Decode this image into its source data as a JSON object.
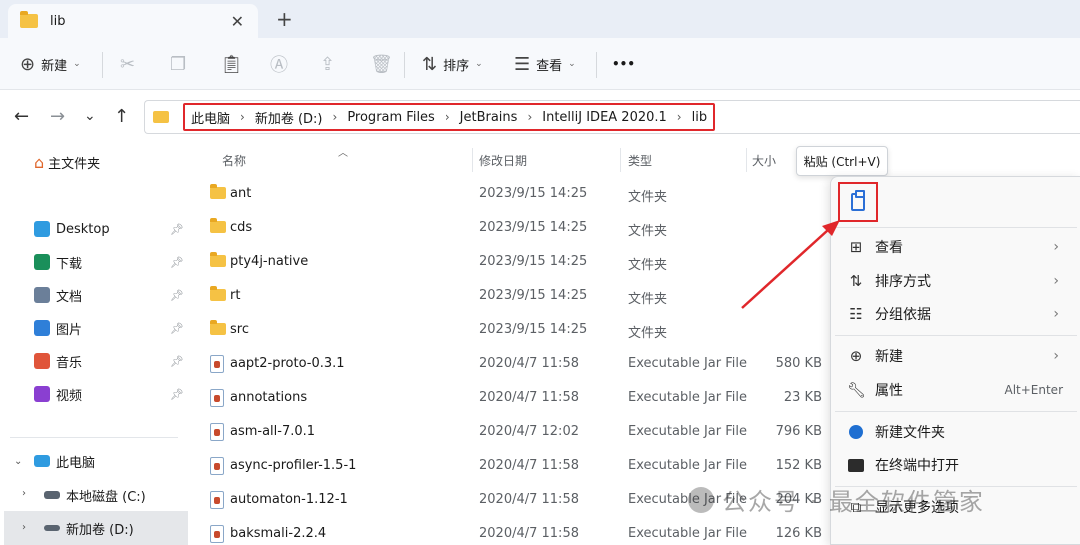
{
  "tab": {
    "title": "lib",
    "close": "✕",
    "add": "+"
  },
  "toolbar": {
    "new_label": "新建",
    "sort_label": "排序",
    "view_label": "查看",
    "more": "•••"
  },
  "nav": {
    "back": "←",
    "forward": "→",
    "recent": "⌄",
    "up": "↑"
  },
  "breadcrumb": [
    "此电脑",
    "新加卷 (D:)",
    "Program Files",
    "JetBrains",
    "IntelliJ IDEA 2020.1",
    "lib"
  ],
  "sidebar": {
    "home": "主文件夹",
    "quick": [
      {
        "label": "Desktop",
        "icon": "desktop-icon",
        "color": "#2f9be0"
      },
      {
        "label": "下载",
        "icon": "download-icon",
        "color": "#1a8f5a"
      },
      {
        "label": "文档",
        "icon": "document-icon",
        "color": "#6b7f99"
      },
      {
        "label": "图片",
        "icon": "picture-icon",
        "color": "#2f7fd8"
      },
      {
        "label": "音乐",
        "icon": "music-icon",
        "color": "#e0553a"
      },
      {
        "label": "视频",
        "icon": "video-icon",
        "color": "#8a3fd1"
      }
    ],
    "this_pc": "此电脑",
    "drive_c": "本地磁盘 (C:)",
    "drive_d": "新加卷 (D:)"
  },
  "columns": {
    "name": "名称",
    "date": "修改日期",
    "type": "类型",
    "size": "大小"
  },
  "files": [
    {
      "name": "ant",
      "date": "2023/9/15 14:25",
      "type": "文件夹",
      "size": "",
      "kind": "folder"
    },
    {
      "name": "cds",
      "date": "2023/9/15 14:25",
      "type": "文件夹",
      "size": "",
      "kind": "folder"
    },
    {
      "name": "pty4j-native",
      "date": "2023/9/15 14:25",
      "type": "文件夹",
      "size": "",
      "kind": "folder"
    },
    {
      "name": "rt",
      "date": "2023/9/15 14:25",
      "type": "文件夹",
      "size": "",
      "kind": "folder"
    },
    {
      "name": "src",
      "date": "2023/9/15 14:25",
      "type": "文件夹",
      "size": "",
      "kind": "folder"
    },
    {
      "name": "aapt2-proto-0.3.1",
      "date": "2020/4/7 11:58",
      "type": "Executable Jar File",
      "size": "580 KB",
      "kind": "jar"
    },
    {
      "name": "annotations",
      "date": "2020/4/7 11:58",
      "type": "Executable Jar File",
      "size": "23 KB",
      "kind": "jar"
    },
    {
      "name": "asm-all-7.0.1",
      "date": "2020/4/7 12:02",
      "type": "Executable Jar File",
      "size": "796 KB",
      "kind": "jar"
    },
    {
      "name": "async-profiler-1.5-1",
      "date": "2020/4/7 11:58",
      "type": "Executable Jar File",
      "size": "152 KB",
      "kind": "jar"
    },
    {
      "name": "automaton-1.12-1",
      "date": "2020/4/7 11:58",
      "type": "Executable Jar File",
      "size": "204 KB",
      "kind": "jar"
    },
    {
      "name": "baksmali-2.2.4",
      "date": "2020/4/7 11:58",
      "type": "Executable Jar File",
      "size": "126 KB",
      "kind": "jar"
    }
  ],
  "tooltip": "粘贴 (Ctrl+V)",
  "context_menu": {
    "view": "查看",
    "sort": "排序方式",
    "group": "分组依据",
    "new": "新建",
    "properties": "属性",
    "properties_shortcut": "Alt+Enter",
    "new_folder": "新建文件夹",
    "open_terminal": "在终端中打开",
    "more_options": "显示更多选项"
  },
  "watermark": "公众号 · 最全软件管家",
  "colors": {
    "highlight": "#e0272b",
    "folder": "#f5c244",
    "accent": "#2b6fd6"
  }
}
